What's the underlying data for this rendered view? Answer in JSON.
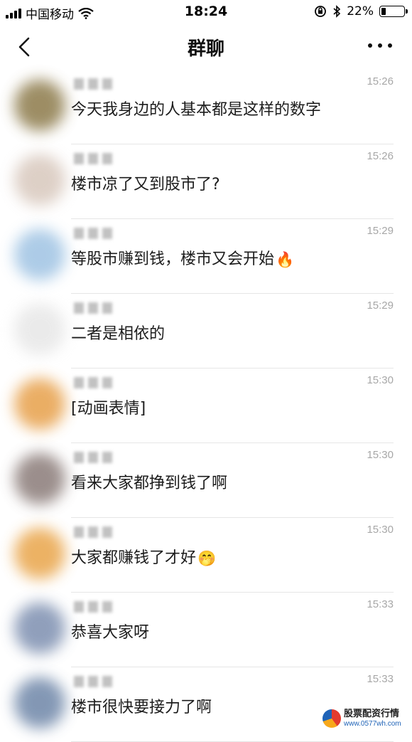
{
  "status_bar": {
    "carrier": "中国移动",
    "time": "18:24",
    "battery": "22%",
    "battery_level": 0.22,
    "icons": [
      "signal-icon",
      "wifi-icon",
      "orientation-lock-icon",
      "bluetooth-icon",
      "battery-icon"
    ]
  },
  "nav": {
    "title": "群聊",
    "back_icon": "chevron-left-icon",
    "more_icon": "more-dots-icon"
  },
  "messages": [
    {
      "time": "15:26",
      "text": "今天我身边的人基本都是这样的数字",
      "emoji": "",
      "avatar_color": "#8c7a4a"
    },
    {
      "time": "15:26",
      "text": "楼市凉了又到股市了?",
      "emoji": "",
      "avatar_color": "#d8c8bd"
    },
    {
      "time": "15:29",
      "text": "等股市赚到钱，楼市又会开始",
      "emoji": "🔥",
      "avatar_color": "#9fc3e3"
    },
    {
      "time": "15:29",
      "text": "二者是相依的",
      "emoji": "",
      "avatar_color": "#e7e7e7"
    },
    {
      "time": "15:30",
      "text": "[动画表情]",
      "emoji": "",
      "avatar_color": "#e7a04a"
    },
    {
      "time": "15:30",
      "text": "看来大家都挣到钱了啊",
      "emoji": "",
      "avatar_color": "#8a7b78"
    },
    {
      "time": "15:30",
      "text": "大家都赚钱了才好",
      "emoji": "🤭",
      "avatar_color": "#e9a54a"
    },
    {
      "time": "15:33",
      "text": "恭喜大家呀",
      "emoji": "",
      "avatar_color": "#7d8fb0"
    },
    {
      "time": "15:33",
      "text": "楼市很快要接力了啊",
      "emoji": "",
      "avatar_color": "#6e86a8"
    }
  ],
  "watermark": {
    "text": "股票配资行情",
    "url": "www.0577wh.com"
  }
}
